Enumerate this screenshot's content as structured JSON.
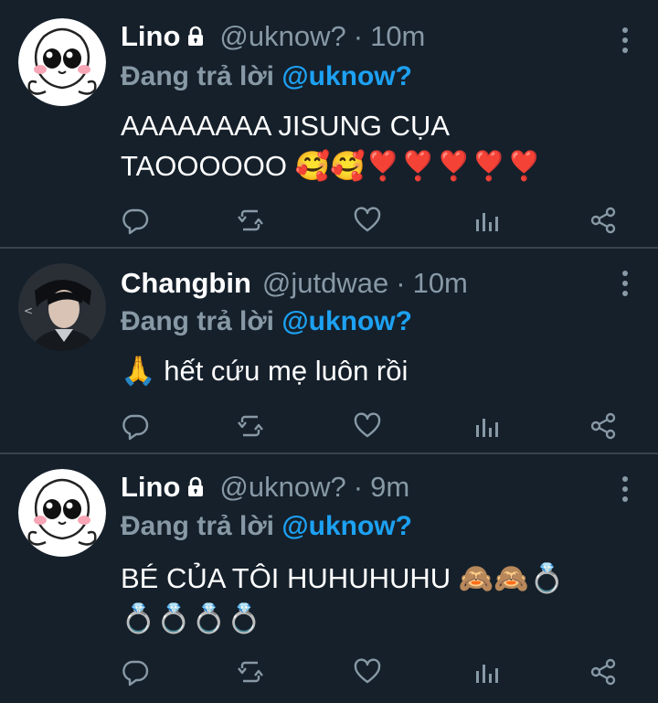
{
  "tweets": [
    {
      "name": "Lino",
      "locked": true,
      "handle": "@uknow?",
      "separator": "·",
      "time": "10m",
      "reply_label": "Đang trả lời",
      "reply_to": "@uknow?",
      "text_line1": "AAAAAAAA JISUNG CỤA",
      "text_line2": "TAOOOOOO 🥰🥰❣️❣️❣️❣️❣️",
      "avatar_icon": "cartoon-bunny-avatar"
    },
    {
      "name": "Changbin",
      "locked": false,
      "handle": "@jutdwae",
      "separator": "·",
      "time": "10m",
      "reply_label": "Đang trả lời",
      "reply_to": "@uknow?",
      "text_line1": "🙏 hết cứu mẹ luôn rồi",
      "avatar_icon": "photo-avatar"
    },
    {
      "name": "Lino",
      "locked": true,
      "handle": "@uknow?",
      "separator": "·",
      "time": "9m",
      "reply_label": "Đang trả lời",
      "reply_to": "@uknow?",
      "text_line1": "BÉ CỦA TÔI HUHUHUHU 🙈🙈💍",
      "text_line2": "💍💍💍💍",
      "avatar_icon": "cartoon-bunny-avatar"
    }
  ],
  "icons": {
    "reply": "reply-icon",
    "retweet": "retweet-icon",
    "like": "heart-icon",
    "analytics": "analytics-icon",
    "share": "share-icon",
    "more": "more-vertical-icon",
    "lock": "lock-icon"
  },
  "colors": {
    "background": "#15202b",
    "secondary_text": "#8899a6",
    "link": "#1da1f2",
    "divider": "#38444d"
  }
}
